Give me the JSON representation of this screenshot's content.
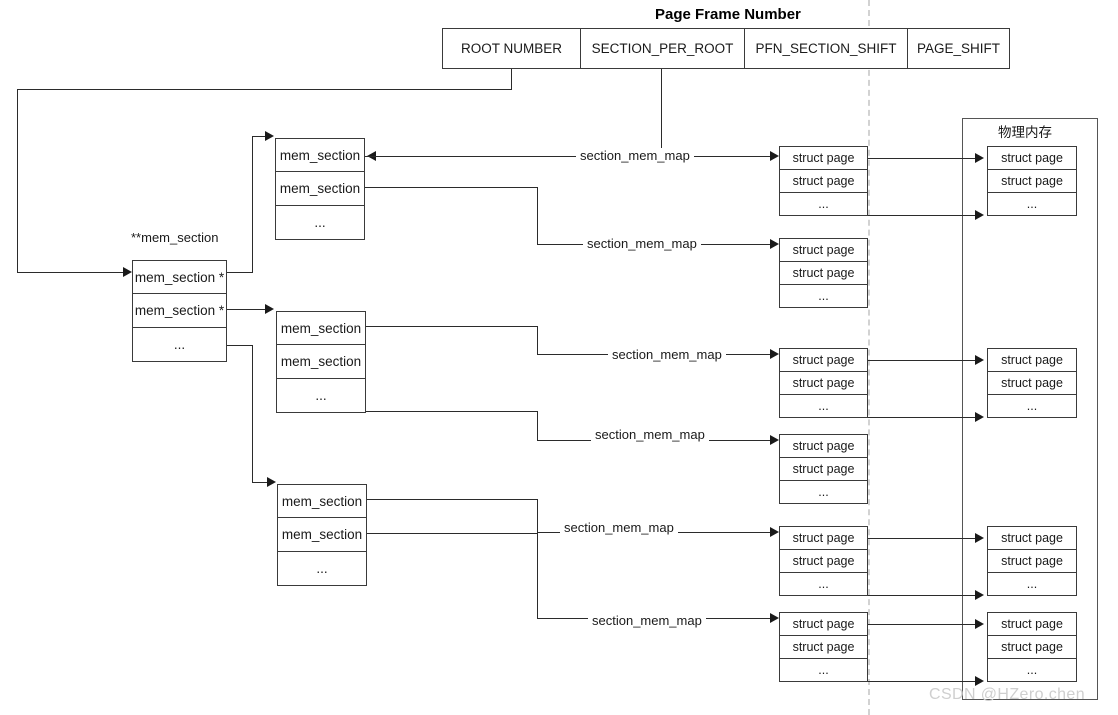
{
  "header": {
    "title": "Page Frame Number",
    "fields": [
      {
        "label": "ROOT NUMBER",
        "width": 138
      },
      {
        "label": "SECTION_PER_ROOT",
        "width": 164
      },
      {
        "label": "PFN_SECTION_SHIFT",
        "width": 163
      },
      {
        "label": "PAGE_SHIFT",
        "width": 101
      }
    ]
  },
  "root_array": {
    "caption": "**mem_section",
    "rows": [
      "mem_section *",
      "mem_section *",
      "..."
    ]
  },
  "section_groups": [
    {
      "rows": [
        "mem_section",
        "mem_section",
        "..."
      ]
    },
    {
      "rows": [
        "mem_section",
        "mem_section",
        "..."
      ]
    },
    {
      "rows": [
        "mem_section",
        "mem_section",
        "..."
      ]
    }
  ],
  "edge_labels": {
    "section_mem_map": "section_mem_map"
  },
  "page_groups": [
    {
      "rows": [
        "struct page",
        "struct page",
        "..."
      ]
    },
    {
      "rows": [
        "struct page",
        "struct page",
        "..."
      ]
    },
    {
      "rows": [
        "struct page",
        "struct page",
        "..."
      ]
    },
    {
      "rows": [
        "struct page",
        "struct page",
        "..."
      ]
    },
    {
      "rows": [
        "struct page",
        "struct page",
        "..."
      ]
    },
    {
      "rows": [
        "struct page",
        "struct page",
        "..."
      ]
    }
  ],
  "physical_memory": {
    "title": "物理内存",
    "page_groups": [
      {
        "rows": [
          "struct page",
          "struct page",
          "..."
        ]
      },
      {
        "rows": [
          "struct page",
          "struct page",
          "..."
        ]
      },
      {
        "rows": [
          "struct page",
          "struct page",
          "..."
        ]
      },
      {
        "rows": [
          "struct page",
          "struct page",
          "..."
        ]
      }
    ]
  },
  "watermark": "CSDN @HZero.chen",
  "colors": {
    "stroke": "#2b2b2b",
    "box_border": "#3a3a3a",
    "text": "#1a1a1a",
    "dashed_guide": "#d2d2d2",
    "watermark": "#cfcfcf",
    "background": "#ffffff"
  }
}
